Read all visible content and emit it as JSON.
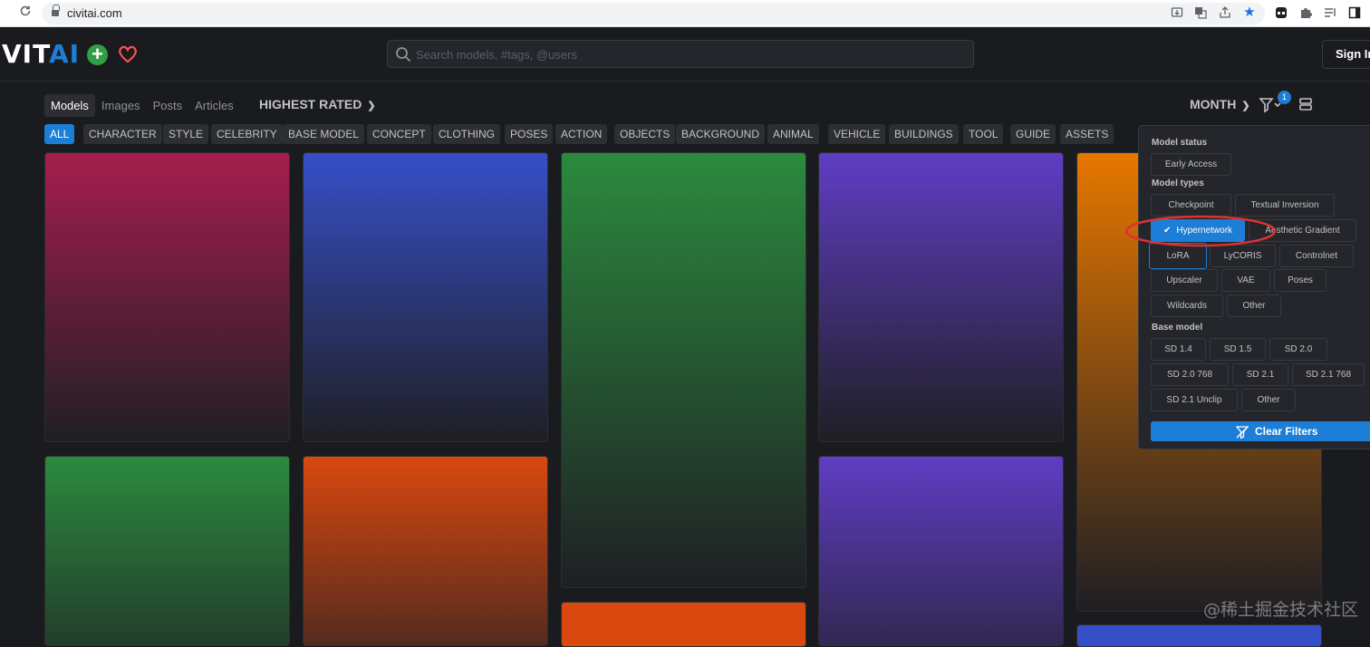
{
  "browser": {
    "url": "civitai.com",
    "icons": [
      "forward-icon",
      "reload-icon",
      "lock-icon",
      "install-icon",
      "translate-icon",
      "share-icon",
      "star-icon",
      "extension-icon",
      "puzzle-icon",
      "reading-list-icon",
      "sidebar-icon"
    ]
  },
  "header": {
    "logo_main": "VIT",
    "logo_accent": "AI",
    "search_placeholder": "Search models, #tags, @users",
    "signin_label": "Sign In"
  },
  "toolbar": {
    "segments": [
      "Models",
      "Images",
      "Posts",
      "Articles"
    ],
    "active_segment": "Models",
    "sort_label": "HIGHEST RATED",
    "period_label": "MONTH",
    "filter_count": "1"
  },
  "tags": [
    "ALL",
    "CHARACTER",
    "STYLE",
    "CELEBRITY",
    "BASE MODEL",
    "CONCEPT",
    "CLOTHING",
    "POSES",
    "ACTION",
    "OBJECTS",
    "BACKGROUND",
    "ANIMAL",
    "VEHICLE",
    "BUILDINGS",
    "TOOL",
    "GUIDE",
    "ASSETS"
  ],
  "active_tag": "ALL",
  "filters": {
    "model_status_title": "Model status",
    "model_status": [
      "Early Access"
    ],
    "model_types_title": "Model types",
    "model_types": [
      "Checkpoint",
      "Textual Inversion",
      "Hypernetwork",
      "Aesthetic Gradient",
      "LoRA",
      "LyCORIS",
      "Controlnet",
      "Upscaler",
      "VAE",
      "Poses",
      "Wildcards",
      "Other"
    ],
    "selected_type": "Hypernetwork",
    "base_model_title": "Base model",
    "base_models": [
      "SD 1.4",
      "SD 1.5",
      "SD 2.0",
      "SD 2.0 768",
      "SD 2.1",
      "SD 2.1 768",
      "SD 2.1 Unclip",
      "Other"
    ],
    "clear_label": "Clear Filters"
  },
  "colors": {
    "accent": "#1c7ed6",
    "card_colors": [
      "#a61e4d",
      "#364fc7",
      "#2b8a3e",
      "#5f3dc4",
      "#e67700",
      "#2b8a3e",
      "#d9480f",
      "#d9480f",
      "#5f3dc4",
      "#364fc7"
    ]
  },
  "watermark": "@稀土掘金技术社区"
}
